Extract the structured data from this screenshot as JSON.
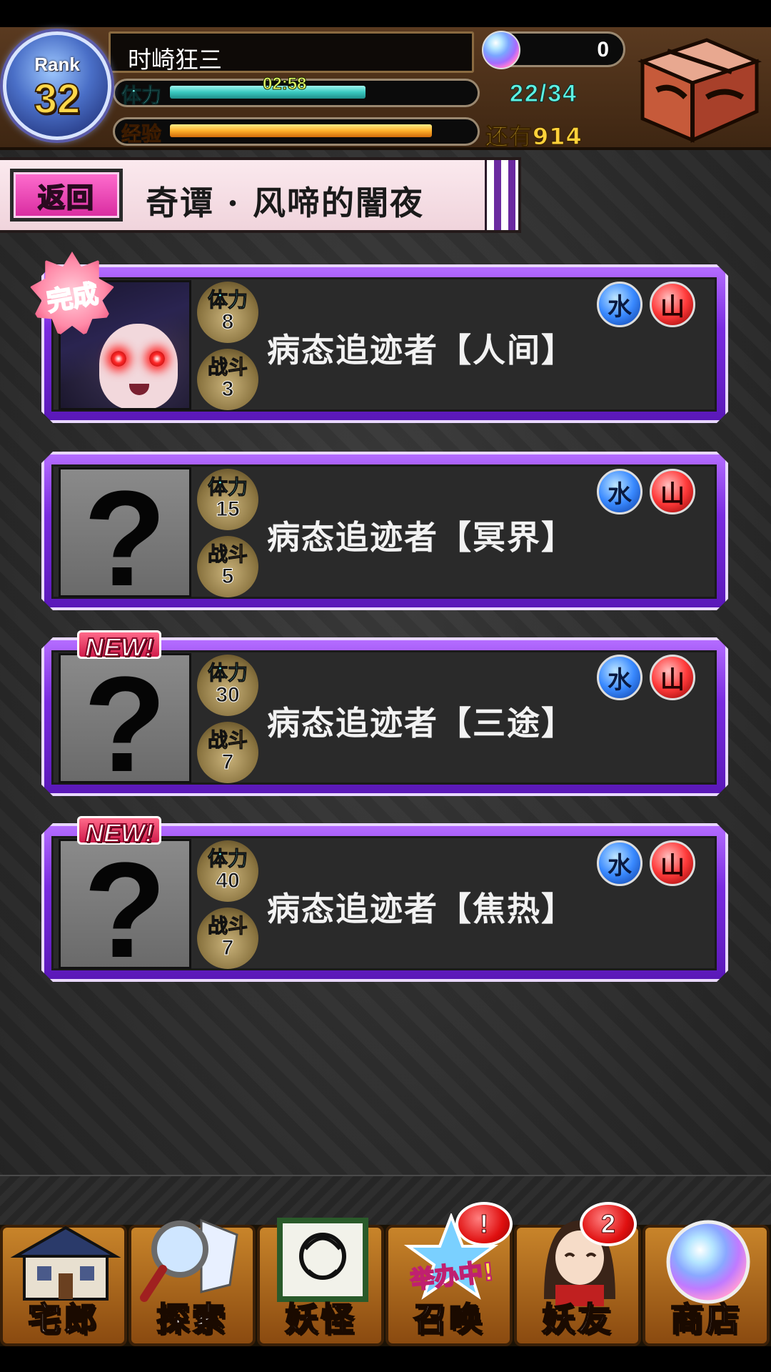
{
  "header": {
    "rank_label": "Rank",
    "rank_value": "32",
    "player_name": "时崎狂三",
    "stamina_label": "体力",
    "stamina_timer": "02:58",
    "stamina_count": "22/34",
    "stamina_fill_fraction": 0.65,
    "exp_label": "经验",
    "exp_remaining": "还有914",
    "exp_fill_fraction": 0.87,
    "orb_count": "0",
    "orb_icon": "crystal-orb-icon",
    "box_icon": "treasure-box-icon"
  },
  "banner": {
    "back_label": "返回",
    "title": "奇谭 · 风啼的闇夜"
  },
  "quests": [
    {
      "name": "病态追迹者【人间】",
      "stamina_label": "体力",
      "stamina": "8",
      "battle_label": "战斗",
      "battles": "3",
      "badge": "完成",
      "revealed": true
    },
    {
      "name": "病态追迹者【冥界】",
      "stamina_label": "体力",
      "stamina": "15",
      "battle_label": "战斗",
      "battles": "5",
      "badge": "",
      "revealed": false
    },
    {
      "name": "病态追迹者【三途】",
      "stamina_label": "体力",
      "stamina": "30",
      "battle_label": "战斗",
      "battles": "7",
      "badge": "NEW!",
      "revealed": false
    },
    {
      "name": "病态追迹者【焦热】",
      "stamina_label": "体力",
      "stamina": "40",
      "battle_label": "战斗",
      "battles": "7",
      "badge": "NEW!",
      "revealed": false
    }
  ],
  "element_icons": [
    "water-element-icon",
    "mountain-element-icon"
  ],
  "nav": [
    {
      "label": "宅郎",
      "icon": "house-icon",
      "badge": ""
    },
    {
      "label": "探索",
      "icon": "magnifier-map-icon",
      "badge": ""
    },
    {
      "label": "妖怪",
      "icon": "scroll-icon",
      "badge": ""
    },
    {
      "label": "召唤",
      "icon": "summon-star-icon",
      "badge": "!",
      "ribbon": "举办中!"
    },
    {
      "label": "妖友",
      "icon": "friend-avatar-icon",
      "badge": "2"
    },
    {
      "label": "商店",
      "icon": "shop-orb-icon",
      "badge": ""
    }
  ],
  "colors": {
    "stamina_text": "#6ff0e6",
    "exp_text": "#ffb43c",
    "card_frame": "#7a2be0",
    "back_button": "#d82a9f",
    "badge_red": "#e01010"
  }
}
